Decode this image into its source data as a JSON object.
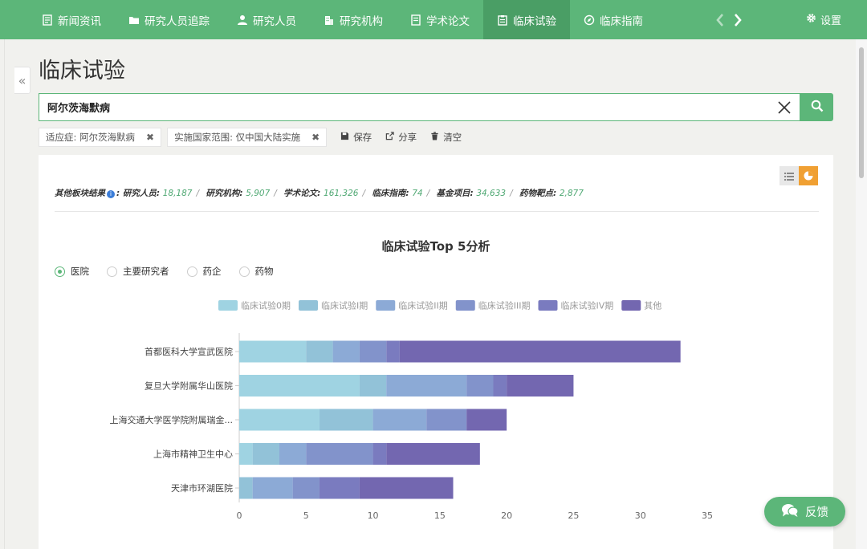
{
  "nav": {
    "items": [
      {
        "label": "新闻资讯",
        "icon": "news-icon"
      },
      {
        "label": "研究人员追踪",
        "icon": "folder-icon"
      },
      {
        "label": "研究人员",
        "icon": "user-icon"
      },
      {
        "label": "研究机构",
        "icon": "building-icon"
      },
      {
        "label": "学术论文",
        "icon": "paper-icon"
      },
      {
        "label": "临床试验",
        "icon": "clipboard-icon",
        "active": true
      },
      {
        "label": "临床指南",
        "icon": "compass-icon"
      }
    ],
    "settings_label": "设置"
  },
  "page": {
    "title": "临床试验"
  },
  "search": {
    "value": "阿尔茨海默病"
  },
  "filters": {
    "tags": [
      "适应症: 阿尔茨海默病",
      "实施国家范围: 仅中国大陆实施"
    ],
    "save_label": "保存",
    "share_label": "分享",
    "clear_label": "清空"
  },
  "summary": {
    "lead": "其他板块结果",
    "items": [
      {
        "label": "研究人员",
        "value": "18,187"
      },
      {
        "label": "研究机构",
        "value": "5,907"
      },
      {
        "label": "学术论文",
        "value": "161,326"
      },
      {
        "label": "临床指南",
        "value": "74"
      },
      {
        "label": "基金项目",
        "value": "34,633"
      },
      {
        "label": "药物靶点",
        "value": "2,877"
      }
    ]
  },
  "radios": {
    "options": [
      "医院",
      "主要研究者",
      "药企",
      "药物"
    ],
    "selected": 0
  },
  "chart_data": {
    "type": "bar",
    "orientation": "horizontal",
    "stacked": true,
    "title": "临床试验Top 5分析",
    "categories": [
      "首都医科大学宣武医院",
      "复旦大学附属华山医院",
      "上海交通大学医学院附属瑞金...",
      "上海市精神卫生中心",
      "天津市环湖医院"
    ],
    "series": [
      {
        "name": "临床试验0期",
        "color": "#9fd3e2",
        "values": [
          5,
          9,
          6,
          1,
          0
        ]
      },
      {
        "name": "临床试验I期",
        "color": "#92c2d8",
        "values": [
          2,
          2,
          4,
          2,
          1
        ]
      },
      {
        "name": "临床试验II期",
        "color": "#8caad6",
        "values": [
          2,
          6,
          4,
          2,
          3
        ]
      },
      {
        "name": "临床试验III期",
        "color": "#8293cb",
        "values": [
          2,
          2,
          3,
          5,
          2
        ]
      },
      {
        "name": "临床试验IV期",
        "color": "#7a7bbf",
        "values": [
          1,
          1,
          0,
          1,
          3
        ]
      },
      {
        "name": "其他",
        "color": "#7367b0",
        "values": [
          21,
          5,
          3,
          7,
          7
        ]
      }
    ],
    "xlim": [
      0,
      35
    ],
    "xticks": [
      0,
      5,
      10,
      15,
      20,
      25,
      30,
      35
    ],
    "legend": "top"
  },
  "feedback": {
    "label": "反馈"
  }
}
